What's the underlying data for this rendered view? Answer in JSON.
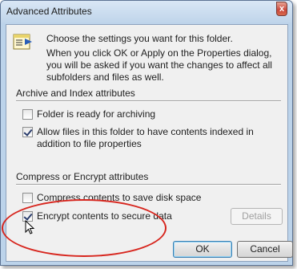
{
  "window": {
    "title": "Advanced Attributes",
    "close_glyph": "x"
  },
  "intro": {
    "line1": "Choose the settings you want for this folder.",
    "line2": "When you click OK or Apply on the Properties dialog, you will be asked if you want the changes to affect all subfolders and files as well."
  },
  "archive_section": {
    "title": "Archive and Index attributes",
    "options": [
      {
        "label": "Folder is ready for archiving",
        "checked": false
      },
      {
        "label": "Allow files in this folder to have contents indexed in addition to file properties",
        "checked": true
      }
    ]
  },
  "compress_section": {
    "title": "Compress or Encrypt attributes",
    "options": [
      {
        "label": "Compress contents to save disk space",
        "checked": false
      },
      {
        "label": "Encrypt contents to secure data",
        "checked": true
      }
    ],
    "details_label": "Details"
  },
  "buttons": {
    "ok": "OK",
    "cancel": "Cancel"
  },
  "colors": {
    "annotation_circle": "#d7261e",
    "titlebar": "#bfd4ea"
  }
}
